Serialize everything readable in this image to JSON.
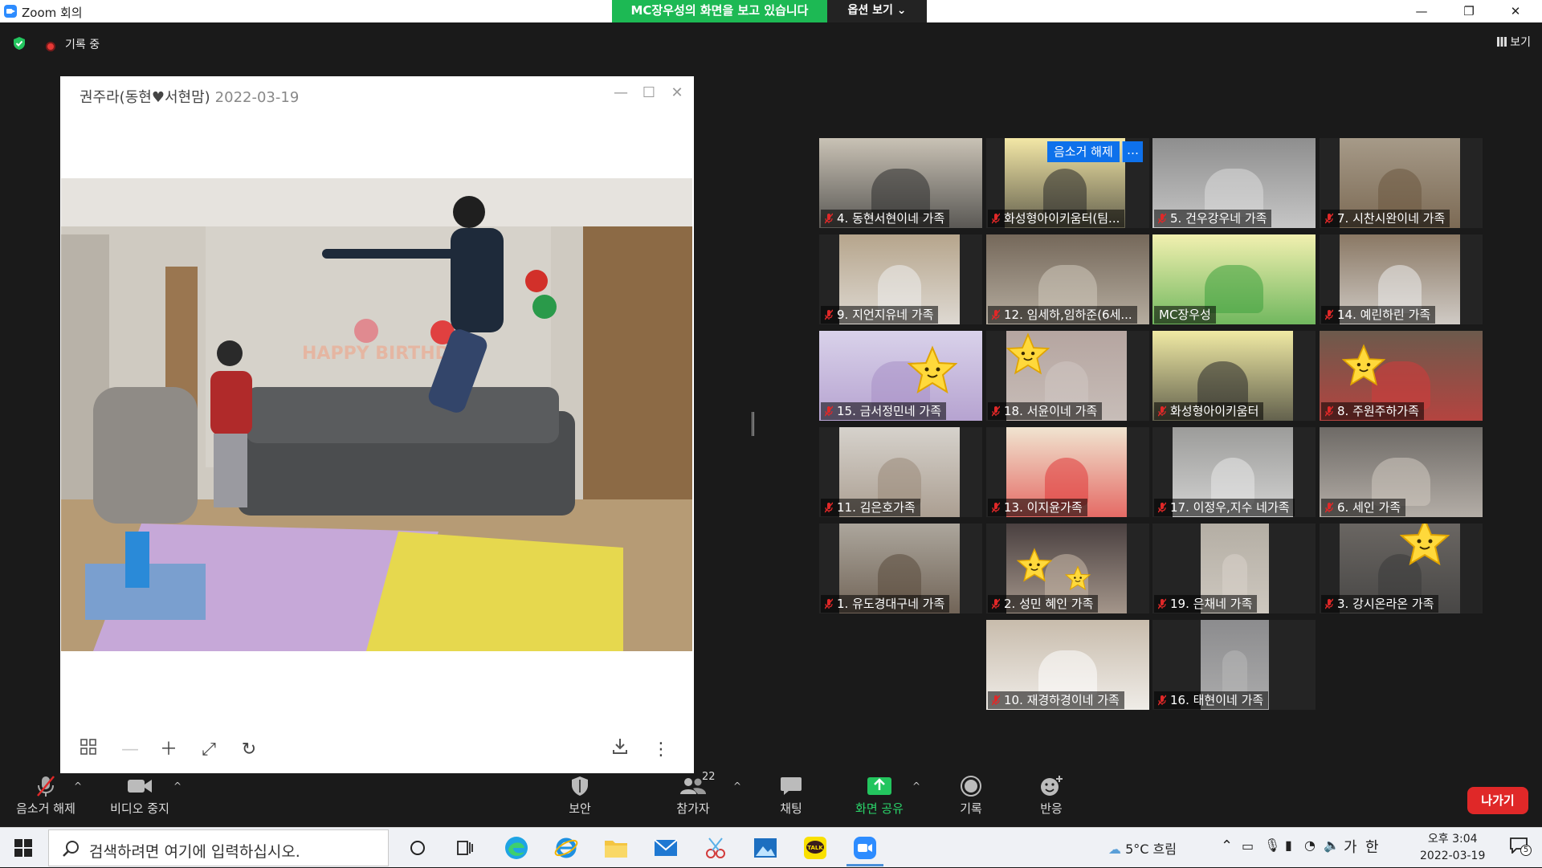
{
  "window": {
    "title": "Zoom 회의",
    "share_banner": "MC장우성의 화면을 보고 있습니다",
    "view_options": "옵션 보기 ⌄",
    "minimize": "—",
    "restore": "❐",
    "close": "✕"
  },
  "status": {
    "recording": "기록 중",
    "view_label": "보기"
  },
  "viewer": {
    "title": "권주라(동현♥서현맘)",
    "date": "2022-03-19",
    "minimize": "—",
    "maximize": "☐",
    "close": "✕"
  },
  "popup": {
    "unmute": "음소거 해제",
    "more": "…"
  },
  "tiles": [
    {
      "name": "4. 동현서현이네 가족"
    },
    {
      "name": "화성형아이키움터(팀..."
    },
    {
      "name": "5. 건우강우네 가족"
    },
    {
      "name": "7. 시찬시완이네 가족"
    },
    {
      "name": "9. 지언지유네 가족"
    },
    {
      "name": "12. 임세하,임하준(6세..."
    },
    {
      "name": "MC장우성"
    },
    {
      "name": "14. 예린하린 가족"
    },
    {
      "name": "15. 금서정민네 가족"
    },
    {
      "name": "18. 서윤이네 가족"
    },
    {
      "name": "화성형아이키움터"
    },
    {
      "name": "8. 주원주하가족"
    },
    {
      "name": "11. 김은호가족"
    },
    {
      "name": "13. 이지윤가족"
    },
    {
      "name": "17. 이정우,지수 네가족"
    },
    {
      "name": "6. 세인 가족"
    },
    {
      "name": "1. 유도경대구네 가족"
    },
    {
      "name": "2. 성민 혜인 가족"
    },
    {
      "name": "19. 은채네 가족"
    },
    {
      "name": "3. 강시온라온 가족"
    },
    {
      "name": "10. 재경하경이네 가족"
    },
    {
      "name": "16. 태현이네 가족"
    }
  ],
  "controls": {
    "unmute": "음소거 해제",
    "stop_video": "비디오 중지",
    "security": "보안",
    "participants": "참가자",
    "participants_count": "22",
    "chat": "채팅",
    "share_screen": "화면 공유",
    "record": "기록",
    "reactions": "반응",
    "leave": "나가기"
  },
  "taskbar": {
    "search_placeholder": "검색하려면 여기에 입력하십시오.",
    "weather": "5°C 흐림",
    "ime": "가",
    "ime2": "한",
    "time": "오후 3:04",
    "date": "2022-03-19",
    "notif_count": "5"
  },
  "colors": {
    "share_green": "#1db954",
    "leave_red": "#e02828",
    "zoom_blue": "#0e71eb",
    "active_speaker": "#d8f05a"
  }
}
